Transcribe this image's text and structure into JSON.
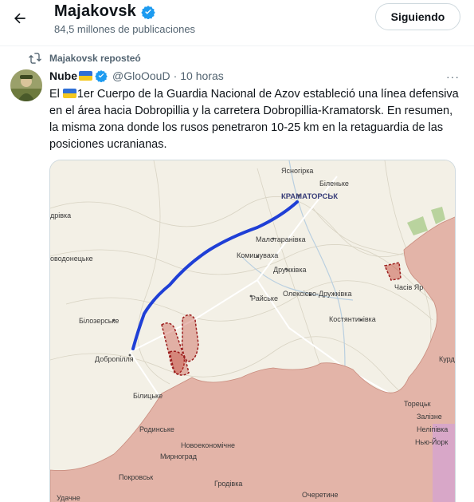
{
  "header": {
    "title": "Majakovsk",
    "subtitle": "84,5 millones de publicaciones",
    "follow_label": "Siguiendo"
  },
  "repost": {
    "text": "Majakovsk reposteó"
  },
  "tweet": {
    "author_name": "Nube",
    "handle": "@GloOouD",
    "separator": "·",
    "time": "10 horas",
    "more": "···",
    "text_before_flag": "El ",
    "text_after_flag": "1er Cuerpo de la Guardia Nacional de Azov estableció una línea defensiva en el área hacia Dobropillia y la carretera Dobropillia-Kramatorsk. En resumen, la misma zona donde los rusos penetraron 10-25 km en la retaguardia de las posiciones ucranianas."
  },
  "map": {
    "labels": [
      {
        "id": "yasnohirka",
        "text": "Ясногірка"
      },
      {
        "id": "bilenke",
        "text": "Біленьке"
      },
      {
        "id": "kramatorsk",
        "text": "КРАМАТОРСЬК"
      },
      {
        "id": "drivka",
        "text": "дрівка"
      },
      {
        "id": "malotaranivka",
        "text": "Малотаранівка"
      },
      {
        "id": "vodonetske",
        "text": "оводонецьке"
      },
      {
        "id": "komyshuvakha",
        "text": "Комишуваха"
      },
      {
        "id": "druzhkivka",
        "text": "Дружківка"
      },
      {
        "id": "chasiv-yar",
        "text": "Часів Яр"
      },
      {
        "id": "raiske",
        "text": "Райське"
      },
      {
        "id": "oleksiievo",
        "text": "Олексієво-Дружківка"
      },
      {
        "id": "bilozerske",
        "text": "Білозерське"
      },
      {
        "id": "kostiantynivka",
        "text": "Костянтинівка"
      },
      {
        "id": "dobropillia",
        "text": "Добропілля"
      },
      {
        "id": "kurd",
        "text": "Курд"
      },
      {
        "id": "bilytske",
        "text": "Білицьке"
      },
      {
        "id": "toretsk",
        "text": "Торецьк"
      },
      {
        "id": "zalizne",
        "text": "Залізне"
      },
      {
        "id": "rodynske",
        "text": "Родинське"
      },
      {
        "id": "neliipivka",
        "text": "Неліпівка"
      },
      {
        "id": "novoekonomichne",
        "text": "Новоекономічне"
      },
      {
        "id": "niu-york",
        "text": "Нью-Йорк"
      },
      {
        "id": "myrnohrad",
        "text": "Мирноград"
      },
      {
        "id": "pokrovsk",
        "text": "Покровськ"
      },
      {
        "id": "hrodivka",
        "text": "Гродівка"
      },
      {
        "id": "udachne",
        "text": "Удачне"
      },
      {
        "id": "ocheretyne",
        "text": "Очеретине"
      }
    ]
  },
  "colors": {
    "accent_blue": "#1d9bf0",
    "defense_line": "#1f3fd6",
    "occupied": "#e3b4a8",
    "salient": "#c0392b",
    "muted_text": "#536471"
  }
}
